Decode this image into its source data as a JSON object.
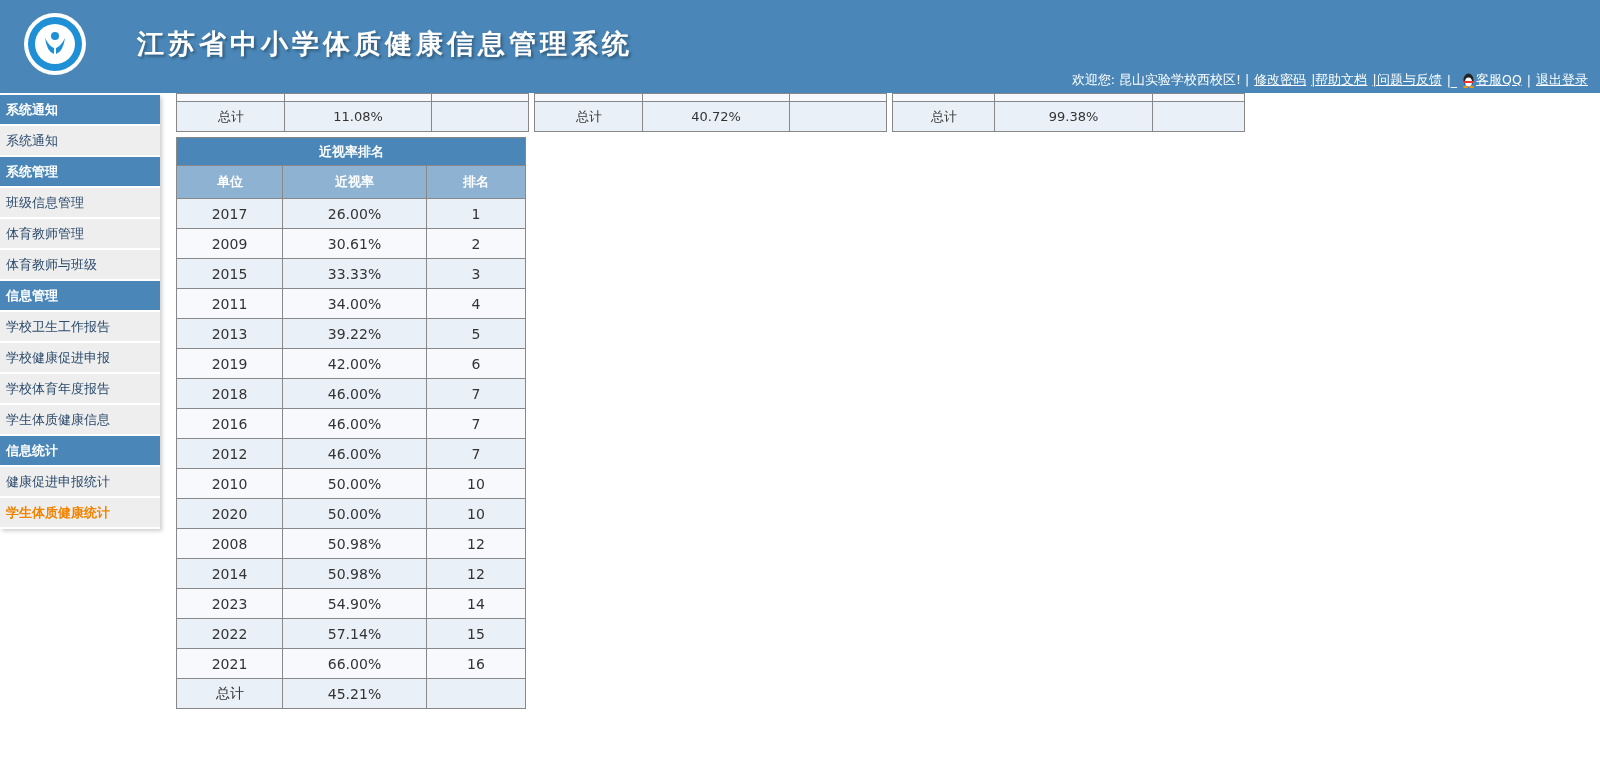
{
  "header": {
    "title": "江苏省中小学体质健康信息管理系统",
    "welcome": "欢迎您: 昆山实验学校西校区! |",
    "links": [
      {
        "label": "修改密码",
        "kind": "link"
      },
      {
        "label": "|帮助文档",
        "kind": "link"
      },
      {
        "label": "|问题与反馈",
        "kind": "link"
      },
      {
        "label": "|_",
        "kind": "text"
      },
      {
        "label": "客服QQ",
        "kind": "qq"
      },
      {
        "label": "|",
        "kind": "text"
      },
      {
        "label": "退出登录",
        "kind": "link"
      }
    ]
  },
  "sidebar": [
    {
      "title": "系统通知",
      "items": [
        {
          "label": "系统通知",
          "selected": false
        }
      ]
    },
    {
      "title": "系统管理",
      "items": [
        {
          "label": "班级信息管理",
          "selected": false
        },
        {
          "label": "体育教师管理",
          "selected": false
        },
        {
          "label": "体育教师与班级",
          "selected": false
        }
      ]
    },
    {
      "title": "信息管理",
      "items": [
        {
          "label": "学校卫生工作报告",
          "selected": false
        },
        {
          "label": "学校健康促进申报",
          "selected": false
        },
        {
          "label": "学校体育年度报告",
          "selected": false
        },
        {
          "label": "学生体质健康信息",
          "selected": false
        }
      ]
    },
    {
      "title": "信息统计",
      "items": [
        {
          "label": "健康促进申报统计",
          "selected": false
        },
        {
          "label": "学生体质健康统计",
          "selected": true
        }
      ]
    }
  ],
  "top_tables": [
    {
      "total": {
        "label": "总计",
        "value": "11.08%"
      }
    },
    {
      "total": {
        "label": "总计",
        "value": "40.72%"
      }
    },
    {
      "total": {
        "label": "总计",
        "value": "99.38%"
      }
    }
  ],
  "ranking": {
    "title": "近视率排名",
    "columns": [
      "单位",
      "近视率",
      "排名"
    ],
    "rows": [
      [
        "2017",
        "26.00%",
        "1"
      ],
      [
        "2009",
        "30.61%",
        "2"
      ],
      [
        "2015",
        "33.33%",
        "3"
      ],
      [
        "2011",
        "34.00%",
        "4"
      ],
      [
        "2013",
        "39.22%",
        "5"
      ],
      [
        "2019",
        "42.00%",
        "6"
      ],
      [
        "2018",
        "46.00%",
        "7"
      ],
      [
        "2016",
        "46.00%",
        "7"
      ],
      [
        "2012",
        "46.00%",
        "7"
      ],
      [
        "2010",
        "50.00%",
        "10"
      ],
      [
        "2020",
        "50.00%",
        "10"
      ],
      [
        "2008",
        "50.98%",
        "12"
      ],
      [
        "2014",
        "50.98%",
        "12"
      ],
      [
        "2023",
        "54.90%",
        "14"
      ],
      [
        "2022",
        "57.14%",
        "15"
      ],
      [
        "2021",
        "66.00%",
        "16"
      ]
    ],
    "total": {
      "label": "总计",
      "value": "45.21%"
    }
  }
}
